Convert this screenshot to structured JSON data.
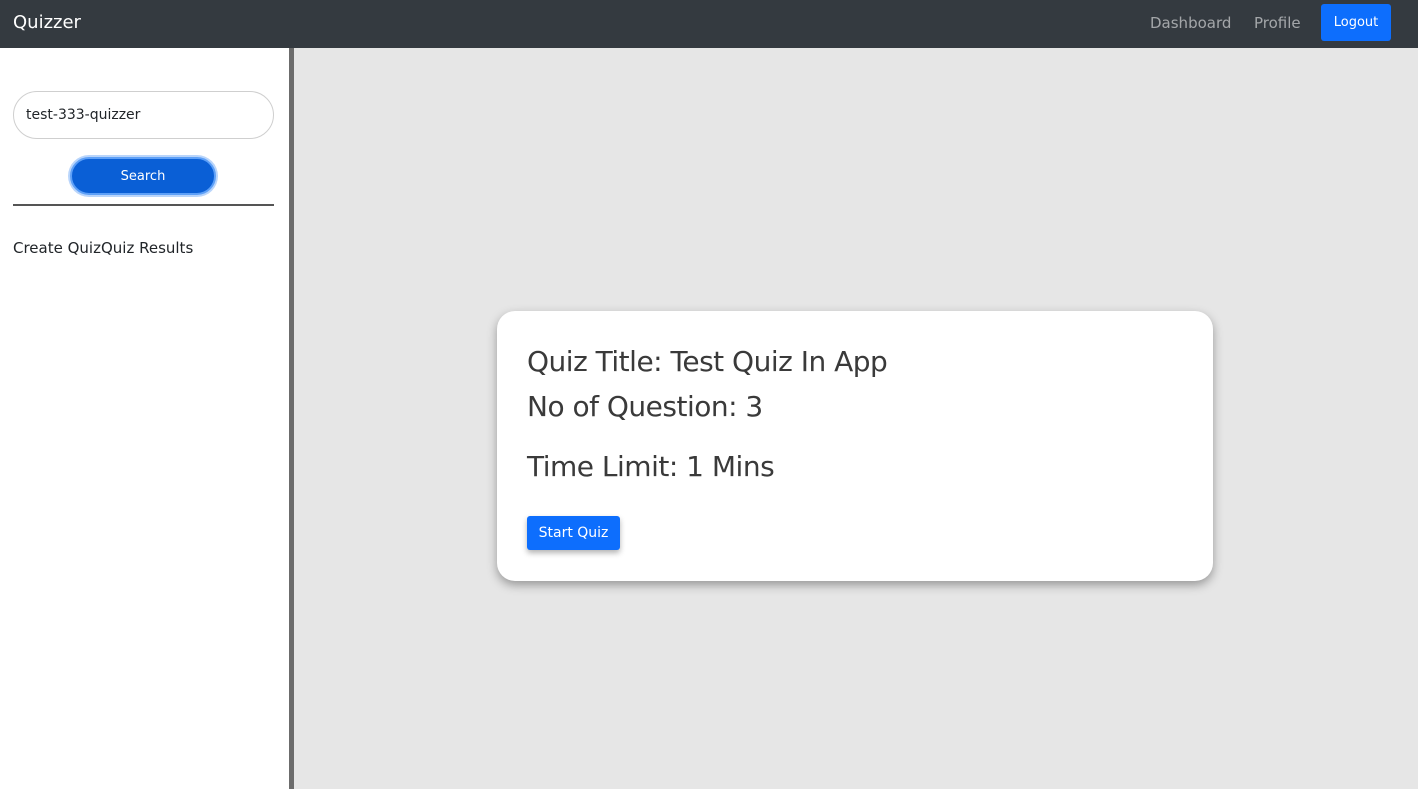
{
  "navbar": {
    "brand": "Quizzer",
    "links": [
      "Dashboard",
      "Profile"
    ],
    "logout_label": "Logout"
  },
  "sidebar": {
    "search_value": "test-333-quizzer",
    "search_button": "Search",
    "links": [
      "Create Quiz",
      "Quiz Results"
    ]
  },
  "quiz_card": {
    "title_line": "Quiz Title: Test Quiz In App",
    "questions_line": "No of Question: 3",
    "time_line": "Time Limit: 1 Mins",
    "start_button": "Start Quiz"
  },
  "colors": {
    "navbar_bg": "#343a40",
    "primary": "#0d6efd",
    "page_bg": "#e6e6e6"
  }
}
